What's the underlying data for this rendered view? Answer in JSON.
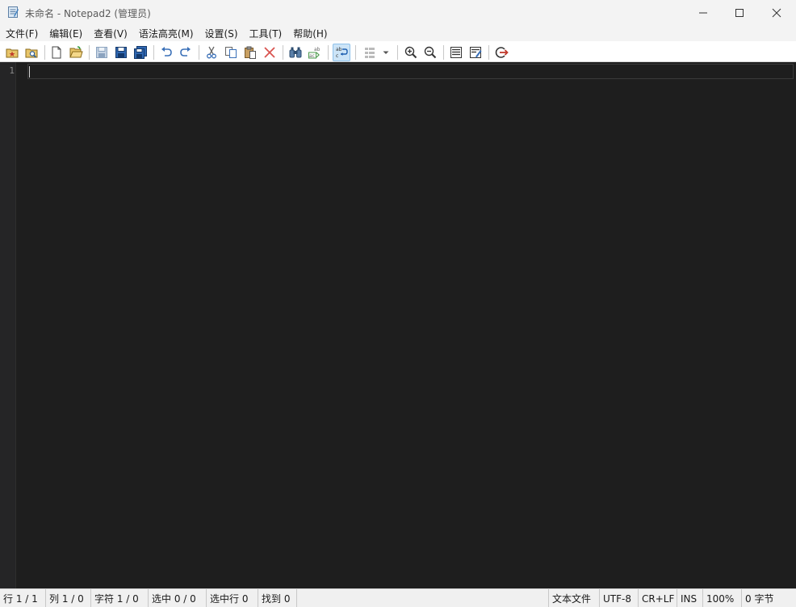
{
  "window": {
    "title": "未命名 - Notepad2 (管理员)",
    "app_icon": "notepad-icon"
  },
  "menu": {
    "items": [
      {
        "label": "文件(F)"
      },
      {
        "label": "编辑(E)"
      },
      {
        "label": "查看(V)"
      },
      {
        "label": "语法高亮(M)"
      },
      {
        "label": "设置(S)"
      },
      {
        "label": "工具(T)"
      },
      {
        "label": "帮助(H)"
      }
    ]
  },
  "toolbar": {
    "buttons": [
      {
        "icon": "favorites-icon"
      },
      {
        "icon": "browse-icon"
      },
      {
        "icon": "new-file-icon"
      },
      {
        "icon": "open-folder-icon"
      },
      {
        "icon": "save-disabled-icon"
      },
      {
        "icon": "save-icon"
      },
      {
        "icon": "save-all-icon"
      },
      {
        "icon": "undo-icon"
      },
      {
        "icon": "redo-icon"
      },
      {
        "icon": "cut-icon"
      },
      {
        "icon": "copy-icon"
      },
      {
        "icon": "paste-icon"
      },
      {
        "icon": "delete-icon"
      },
      {
        "icon": "find-icon"
      },
      {
        "icon": "replace-icon"
      },
      {
        "icon": "word-wrap-icon"
      },
      {
        "icon": "schema-icon"
      },
      {
        "icon": "dropdown-arrow-icon"
      },
      {
        "icon": "zoom-in-icon"
      },
      {
        "icon": "zoom-out-icon"
      },
      {
        "icon": "settings-list-icon"
      },
      {
        "icon": "edit-schema-icon"
      },
      {
        "icon": "exit-icon"
      }
    ],
    "active_button": "word-wrap-icon"
  },
  "editor": {
    "line_numbers": [
      "1"
    ],
    "theme": {
      "background": "#1e1e1e",
      "gutter": "#252526"
    }
  },
  "status": {
    "line": "行 1 / 1",
    "column": "列 1 / 0",
    "char": "字符 1 / 0",
    "selection": "选中 0 / 0",
    "selected_lines": "选中行 0",
    "found": "找到 0",
    "file_type": "文本文件",
    "encoding": "UTF-8",
    "line_ending": "CR+LF",
    "insert_mode": "INS",
    "zoom": "100%",
    "size": "0 字节"
  }
}
